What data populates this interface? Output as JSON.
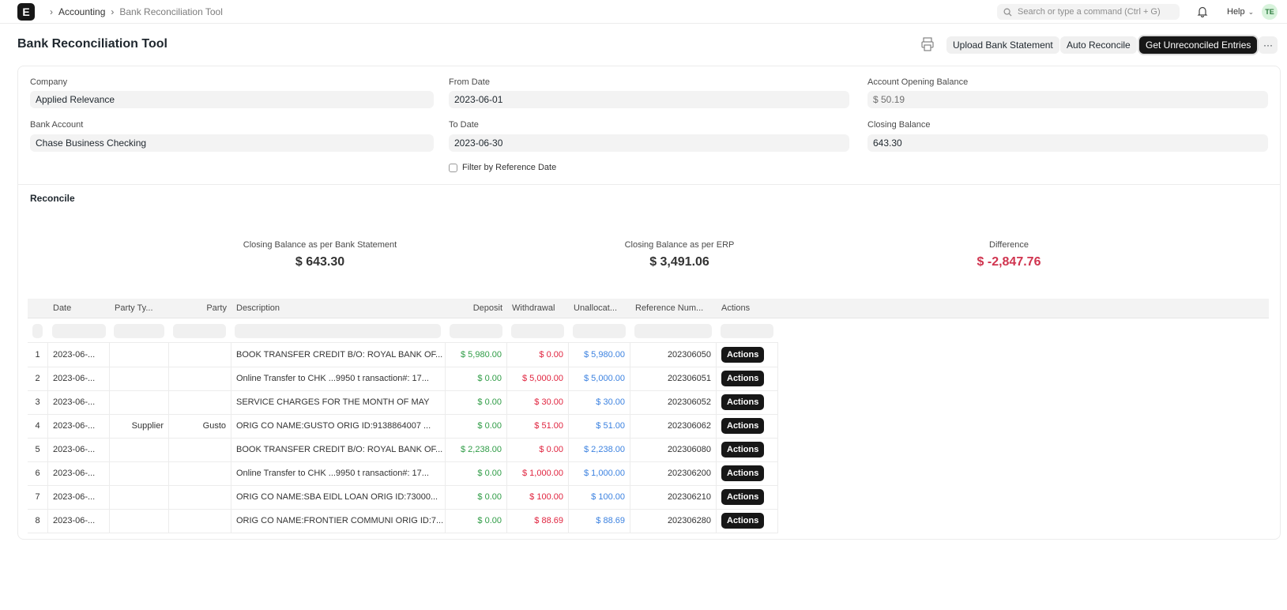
{
  "breadcrumb": {
    "items": [
      "Accounting",
      "Bank Reconciliation Tool"
    ]
  },
  "logo_letter": "E",
  "search": {
    "placeholder": "Search or type a command (Ctrl + G)"
  },
  "help_label": "Help",
  "avatar_initials": "TE",
  "page": {
    "title": "Bank Reconciliation Tool"
  },
  "actions": {
    "upload": "Upload Bank Statement",
    "auto": "Auto Reconcile",
    "get_unreconciled": "Get Unreconciled Entries",
    "more": "···"
  },
  "form": {
    "company_label": "Company",
    "company": "Applied Relevance",
    "bank_account_label": "Bank Account",
    "bank_account": "Chase Business Checking",
    "from_date_label": "From Date",
    "from_date": "2023-06-01",
    "to_date_label": "To Date",
    "to_date": "2023-06-30",
    "filter_ref_label": "Filter by Reference Date",
    "opening_label": "Account Opening Balance",
    "opening": "$ 50.19",
    "closing_label": "Closing Balance",
    "closing": "643.30"
  },
  "reconcile": {
    "title": "Reconcile",
    "bank_label": "Closing Balance as per Bank Statement",
    "bank_value": "$ 643.30",
    "erp_label": "Closing Balance as per ERP",
    "erp_value": "$ 3,491.06",
    "diff_label": "Difference",
    "diff_value": "$ -2,847.76"
  },
  "table": {
    "columns": [
      "Date",
      "Party Ty...",
      "Party",
      "Description",
      "Deposit",
      "Withdrawal",
      "Unallocat...",
      "Reference Num...",
      "Actions"
    ],
    "action_label": "Actions",
    "rows": [
      {
        "n": "1",
        "date": "2023-06-...",
        "party_type": "",
        "party": "",
        "desc": "BOOK TRANSFER CREDIT B/O: ROYAL BANK OF...",
        "deposit": "$ 5,980.00",
        "withdrawal": "$ 0.00",
        "unalloc": "$ 5,980.00",
        "ref": "202306050"
      },
      {
        "n": "2",
        "date": "2023-06-...",
        "party_type": "",
        "party": "",
        "desc": "Online Transfer to CHK ...9950 t ransaction#: 17...",
        "deposit": "$ 0.00",
        "withdrawal": "$ 5,000.00",
        "unalloc": "$ 5,000.00",
        "ref": "202306051"
      },
      {
        "n": "3",
        "date": "2023-06-...",
        "party_type": "",
        "party": "",
        "desc": "SERVICE CHARGES FOR THE MONTH OF MAY",
        "deposit": "$ 0.00",
        "withdrawal": "$ 30.00",
        "unalloc": "$ 30.00",
        "ref": "202306052"
      },
      {
        "n": "4",
        "date": "2023-06-...",
        "party_type": "Supplier",
        "party": "Gusto",
        "desc": "ORIG CO NAME:GUSTO ORIG ID:9138864007 ...",
        "deposit": "$ 0.00",
        "withdrawal": "$ 51.00",
        "unalloc": "$ 51.00",
        "ref": "202306062"
      },
      {
        "n": "5",
        "date": "2023-06-...",
        "party_type": "",
        "party": "",
        "desc": "BOOK TRANSFER CREDIT B/O: ROYAL BANK OF...",
        "deposit": "$ 2,238.00",
        "withdrawal": "$ 0.00",
        "unalloc": "$ 2,238.00",
        "ref": "202306080"
      },
      {
        "n": "6",
        "date": "2023-06-...",
        "party_type": "",
        "party": "",
        "desc": "Online Transfer to CHK ...9950 t ransaction#: 17...",
        "deposit": "$ 0.00",
        "withdrawal": "$ 1,000.00",
        "unalloc": "$ 1,000.00",
        "ref": "202306200"
      },
      {
        "n": "7",
        "date": "2023-06-...",
        "party_type": "",
        "party": "",
        "desc": "ORIG CO NAME:SBA EIDL LOAN ORIG ID:73000...",
        "deposit": "$ 0.00",
        "withdrawal": "$ 100.00",
        "unalloc": "$ 100.00",
        "ref": "202306210"
      },
      {
        "n": "8",
        "date": "2023-06-...",
        "party_type": "",
        "party": "",
        "desc": "ORIG CO NAME:FRONTIER COMMUNI ORIG ID:7...",
        "deposit": "$ 0.00",
        "withdrawal": "$ 88.69",
        "unalloc": "$ 88.69",
        "ref": "202306280"
      }
    ]
  },
  "colors": {
    "deposit": "#2f9c46",
    "withdrawal": "#e0243f",
    "unallocated": "#3c82e0",
    "difference": "#d0344f",
    "primary": "#171717"
  }
}
